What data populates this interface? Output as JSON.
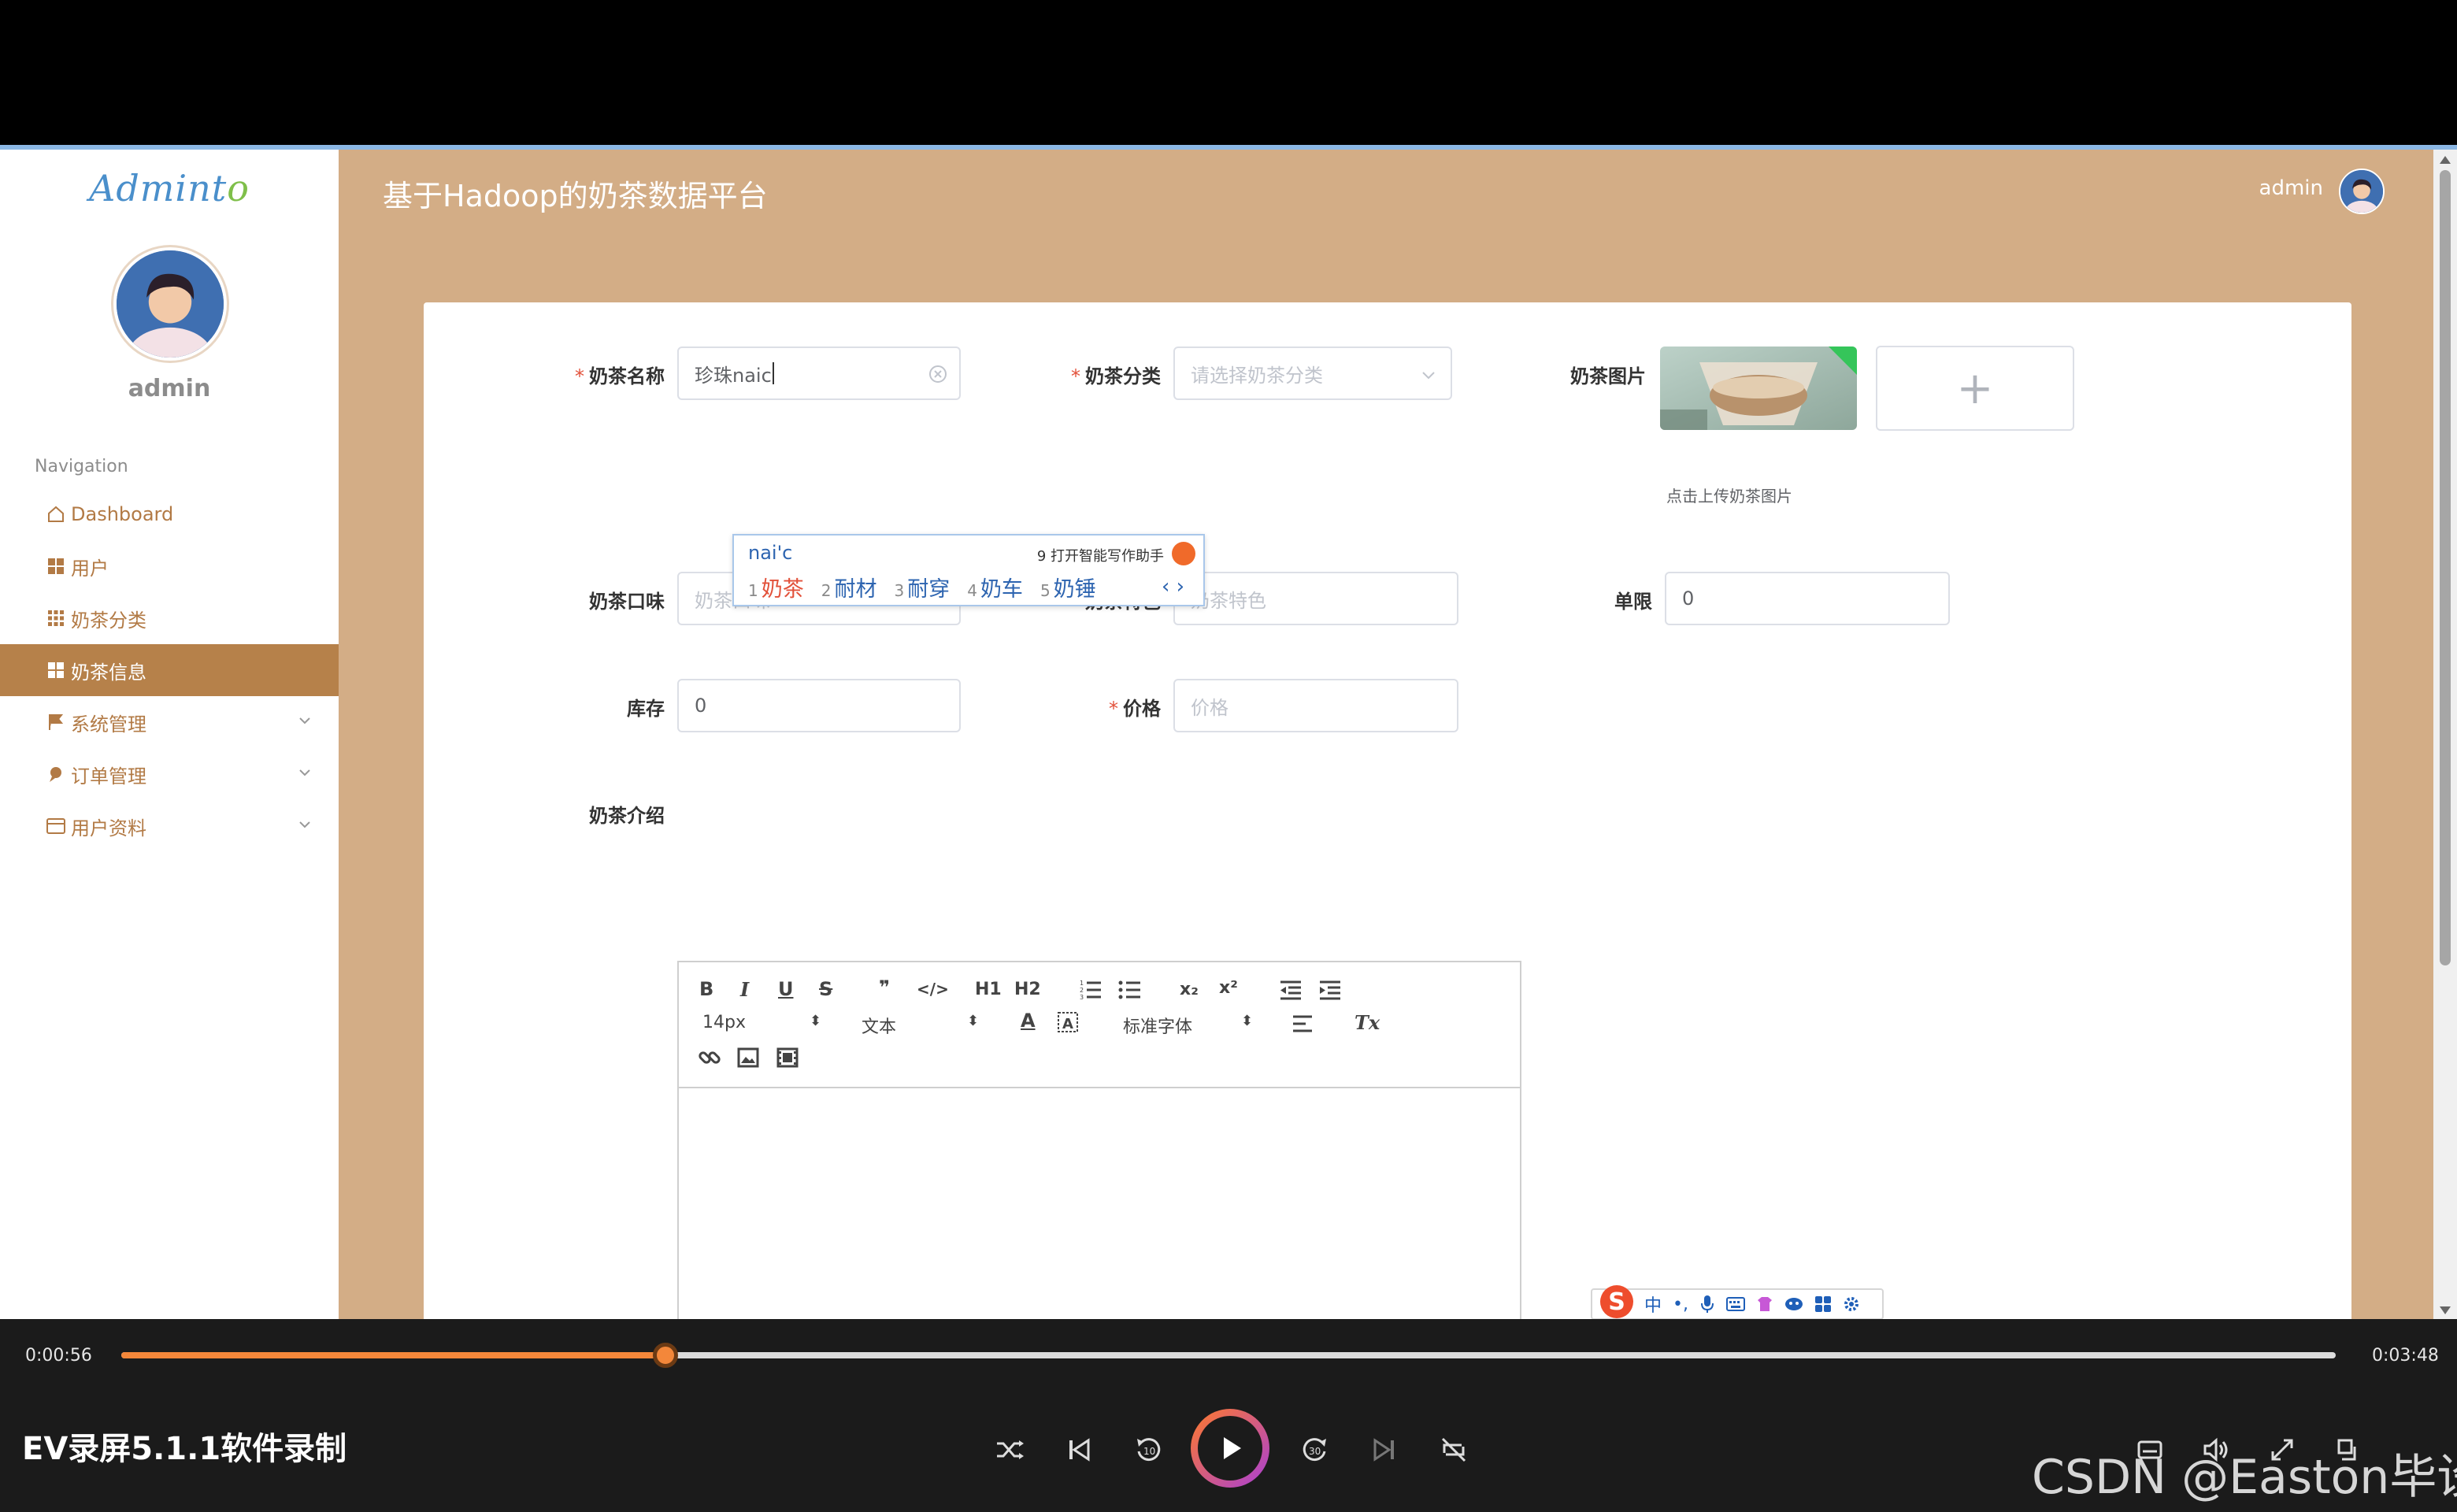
{
  "sidebar": {
    "brand": "Adminto",
    "username": "admin",
    "nav_title": "Navigation",
    "items": [
      {
        "label": "Dashboard"
      },
      {
        "label": "用户"
      },
      {
        "label": "奶茶分类"
      },
      {
        "label": "奶茶信息"
      },
      {
        "label": "系统管理"
      },
      {
        "label": "订单管理"
      },
      {
        "label": "用户资料"
      }
    ]
  },
  "header": {
    "title": "基于Hadoop的奶茶数据平台",
    "user": "admin"
  },
  "form": {
    "name": {
      "label": "奶茶名称",
      "value": "珍珠naic"
    },
    "category": {
      "label": "奶茶分类",
      "placeholder": "请选择奶茶分类"
    },
    "image": {
      "label": "奶茶图片",
      "hint": "点击上传奶茶图片",
      "add": "+"
    },
    "flavor": {
      "label": "奶茶口味",
      "placeholder": "奶茶口味"
    },
    "feature": {
      "label": "奶茶特色",
      "placeholder": "奶茶特色"
    },
    "limit": {
      "label": "单限",
      "value": "0"
    },
    "stock": {
      "label": "库存",
      "value": "0"
    },
    "price": {
      "label": "价格",
      "placeholder": "价格"
    },
    "intro": {
      "label": "奶茶介绍"
    },
    "required_mark": "*"
  },
  "ime": {
    "pinyin": "nai'c",
    "assist": "9 打开智能写作助手",
    "candidates": [
      {
        "n": "1",
        "text": "奶茶"
      },
      {
        "n": "2",
        "text": "耐材"
      },
      {
        "n": "3",
        "text": "耐穿"
      },
      {
        "n": "4",
        "text": "奶车"
      },
      {
        "n": "5",
        "text": "奶锤"
      }
    ],
    "pager": "‹ ›"
  },
  "editor": {
    "font_size": "14px",
    "block": "文本",
    "font_family": "标准字体",
    "buttons": [
      "B",
      "I",
      "U",
      "S",
      "❞",
      "</>",
      "H1",
      "H2",
      "x₂",
      "x²",
      "A",
      "Tx"
    ]
  },
  "sogou": {
    "logo": "S",
    "mode": "中"
  },
  "player": {
    "current": "0:00:56",
    "total": "0:03:48",
    "progress": 0.2456,
    "title": "EV录屏5.1.1软件录制",
    "watermark": "CSDN @Easton毕设"
  },
  "colors": {
    "header_bg": "#d3ad86",
    "active_nav": "#b6814a",
    "accent_orange": "#f3873a"
  }
}
